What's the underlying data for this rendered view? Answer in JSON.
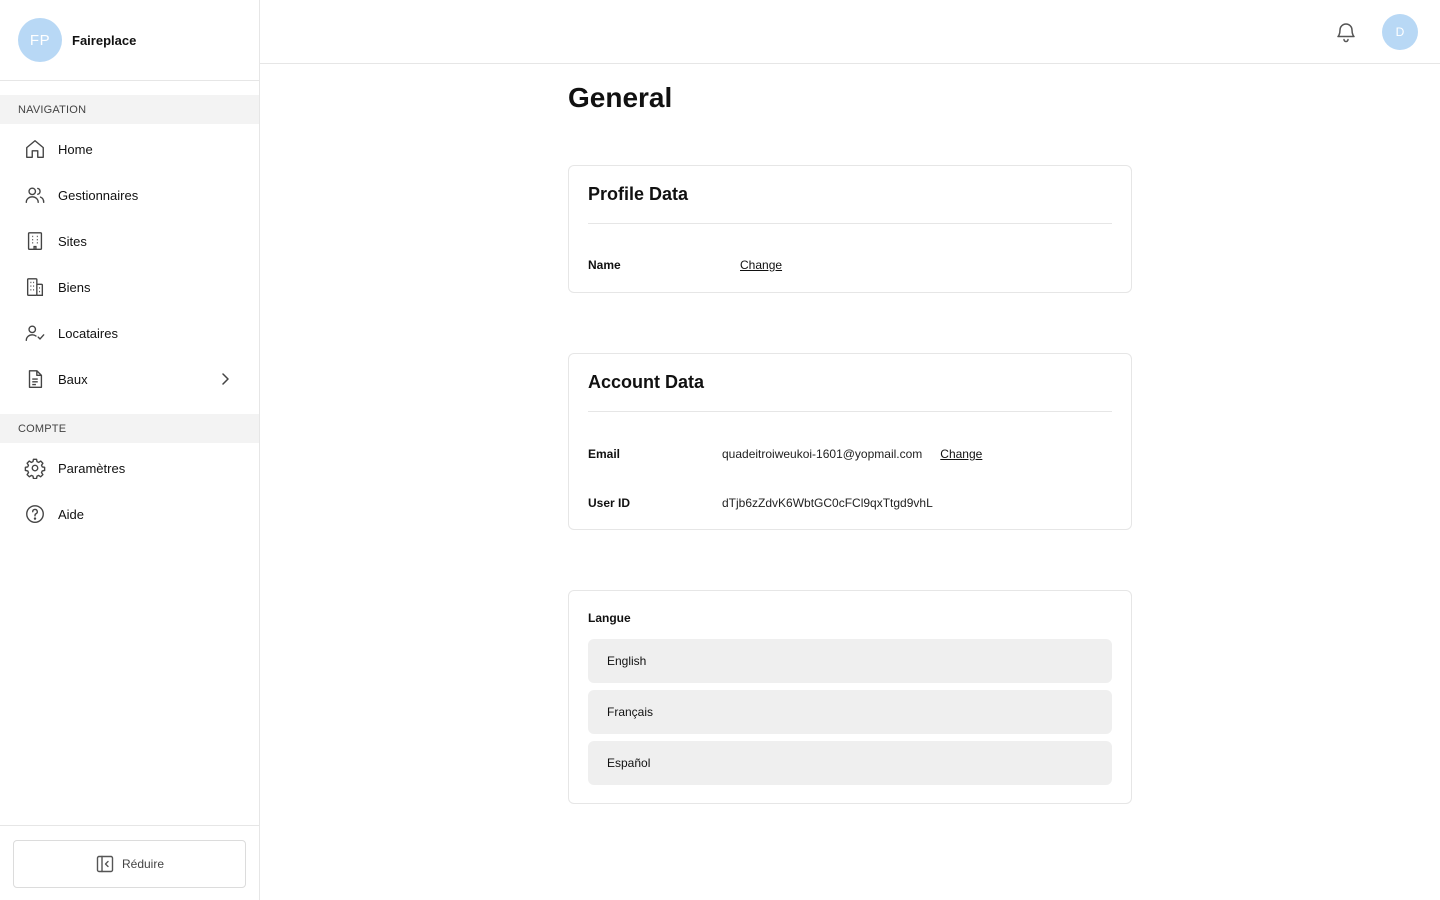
{
  "brand": {
    "initials": "FP",
    "name": "Faireplace"
  },
  "sidebar": {
    "navigation_heading": "NAVIGATION",
    "nav_items": [
      {
        "label": "Home",
        "icon": "home-icon"
      },
      {
        "label": "Gestionnaires",
        "icon": "users-icon"
      },
      {
        "label": "Sites",
        "icon": "building-icon"
      },
      {
        "label": "Biens",
        "icon": "buildings-icon"
      },
      {
        "label": "Locataires",
        "icon": "user-check-icon"
      },
      {
        "label": "Baux",
        "icon": "document-icon",
        "has_submenu": true
      }
    ],
    "account_heading": "COMPTE",
    "account_items": [
      {
        "label": "Paramètres",
        "icon": "gear-icon"
      },
      {
        "label": "Aide",
        "icon": "help-circle-icon"
      }
    ],
    "collapse_label": "Réduire"
  },
  "header": {
    "user_initial": "D"
  },
  "main": {
    "title": "General",
    "profile": {
      "title": "Profile Data",
      "name_label": "Name",
      "change_label": "Change"
    },
    "account": {
      "title": "Account Data",
      "email_label": "Email",
      "email_value": "quadeitroiweukoi-1601@yopmail.com",
      "change_label": "Change",
      "userid_label": "User ID",
      "userid_value": "dTjb6zZdvK6WbtGC0cFCl9qxTtgd9vhL"
    },
    "language": {
      "label": "Langue",
      "options": [
        "English",
        "Français",
        "Español"
      ]
    }
  },
  "colors": {
    "avatar_bg": "#b8d8f5",
    "option_bg": "#efefef",
    "border": "#e6e6e6"
  }
}
